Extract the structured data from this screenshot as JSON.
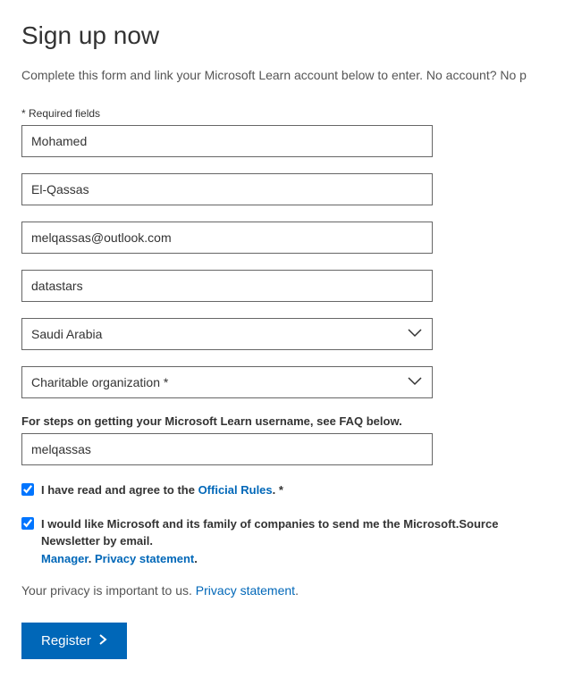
{
  "title": "Sign up now",
  "intro": "Complete this form and link your Microsoft Learn account below to enter. No account? No p",
  "requiredLabel": "* Required fields",
  "fields": {
    "firstName": "Mohamed",
    "lastName": "El-Qassas",
    "email": "melqassas@outlook.com",
    "company": "datastars",
    "country": "Saudi Arabia",
    "orgType": "Charitable organization *",
    "username": "melqassas"
  },
  "helperText": "For steps on getting your Microsoft Learn username, see FAQ below.",
  "checkbox1": {
    "prefix": "I have read and agree to the ",
    "link": "Official Rules",
    "suffix": ". *"
  },
  "checkbox2": {
    "line1": "I would like Microsoft and its family of companies to send me the Microsoft.Source Newsletter by email.",
    "managerLink": "Manager",
    "privacyLink": "Privacy statement",
    "dot": "."
  },
  "privacy": {
    "text": "Your privacy is important to us. ",
    "link": "Privacy statement",
    "dot": "."
  },
  "registerLabel": "Register"
}
